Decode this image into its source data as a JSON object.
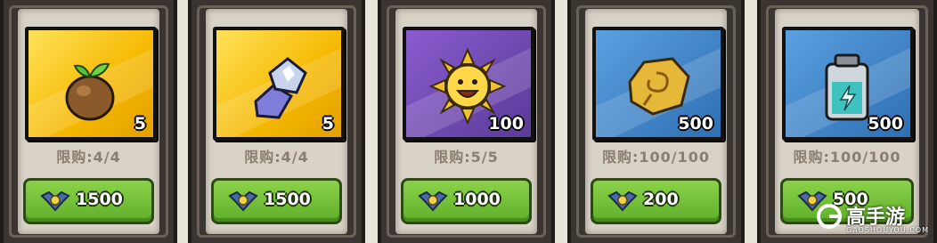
{
  "items": [
    {
      "name": "seed",
      "quantity": "5",
      "limit": "限购:4/4",
      "price": "1500",
      "tile_color": "gold",
      "icon": "seed-icon"
    },
    {
      "name": "crystal-ore",
      "quantity": "5",
      "limit": "限购:4/4",
      "price": "1500",
      "tile_color": "gold",
      "icon": "crystal-icon"
    },
    {
      "name": "sun",
      "quantity": "100",
      "limit": "限购:5/5",
      "price": "1000",
      "tile_color": "purple",
      "icon": "sun-icon"
    },
    {
      "name": "rune-stone",
      "quantity": "500",
      "limit": "限购:100/100",
      "price": "200",
      "tile_color": "blue",
      "icon": "rune-stone-icon"
    },
    {
      "name": "energy-battery",
      "quantity": "500",
      "limit": "限购:100/100",
      "price": "500",
      "tile_color": "blue",
      "icon": "battery-icon"
    }
  ],
  "currency_icon": "emblem-coin-icon",
  "watermark": {
    "text": "高手游",
    "sub": "GAOSHOUYOU.COM"
  }
}
